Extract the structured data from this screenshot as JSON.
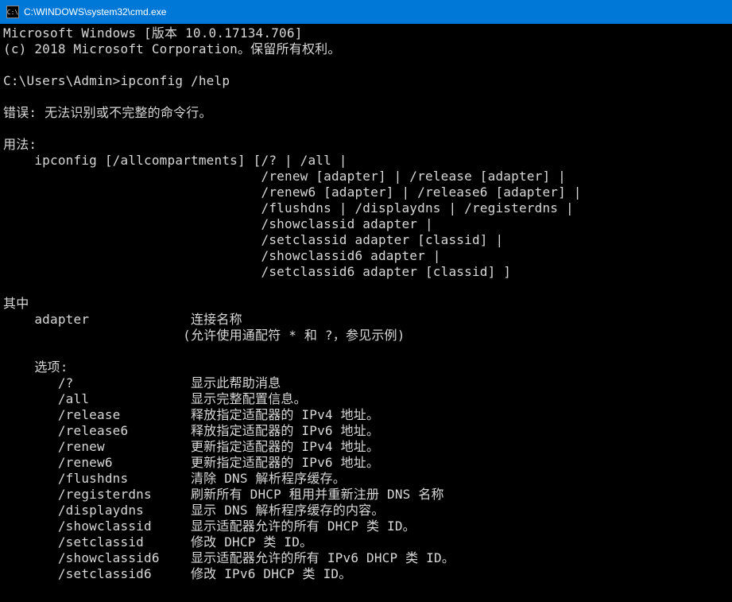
{
  "titlebar": {
    "icon_label": "C:\\",
    "title": "C:\\WINDOWS\\system32\\cmd.exe"
  },
  "console": {
    "lines": [
      "Microsoft Windows [版本 10.0.17134.706]",
      "(c) 2018 Microsoft Corporation。保留所有权利。",
      "",
      "C:\\Users\\Admin>ipconfig /help",
      "",
      "错误: 无法识别或不完整的命令行。",
      "",
      "用法:",
      "    ipconfig [/allcompartments] [/? | /all |",
      "                                 /renew [adapter] | /release [adapter] |",
      "                                 /renew6 [adapter] | /release6 [adapter] |",
      "                                 /flushdns | /displaydns | /registerdns |",
      "                                 /showclassid adapter |",
      "                                 /setclassid adapter [classid] |",
      "                                 /showclassid6 adapter |",
      "                                 /setclassid6 adapter [classid] ]",
      "",
      "其中",
      "    adapter             连接名称",
      "                       (允许使用通配符 * 和 ?，参见示例)",
      "",
      "    选项:",
      "       /?               显示此帮助消息",
      "       /all             显示完整配置信息。",
      "       /release         释放指定适配器的 IPv4 地址。",
      "       /release6        释放指定适配器的 IPv6 地址。",
      "       /renew           更新指定适配器的 IPv4 地址。",
      "       /renew6          更新指定适配器的 IPv6 地址。",
      "       /flushdns        清除 DNS 解析程序缓存。",
      "       /registerdns     刷新所有 DHCP 租用并重新注册 DNS 名称",
      "       /displaydns      显示 DNS 解析程序缓存的内容。",
      "       /showclassid     显示适配器允许的所有 DHCP 类 ID。",
      "       /setclassid      修改 DHCP 类 ID。",
      "       /showclassid6    显示适配器允许的所有 IPv6 DHCP 类 ID。",
      "       /setclassid6     修改 IPv6 DHCP 类 ID。",
      ""
    ]
  }
}
